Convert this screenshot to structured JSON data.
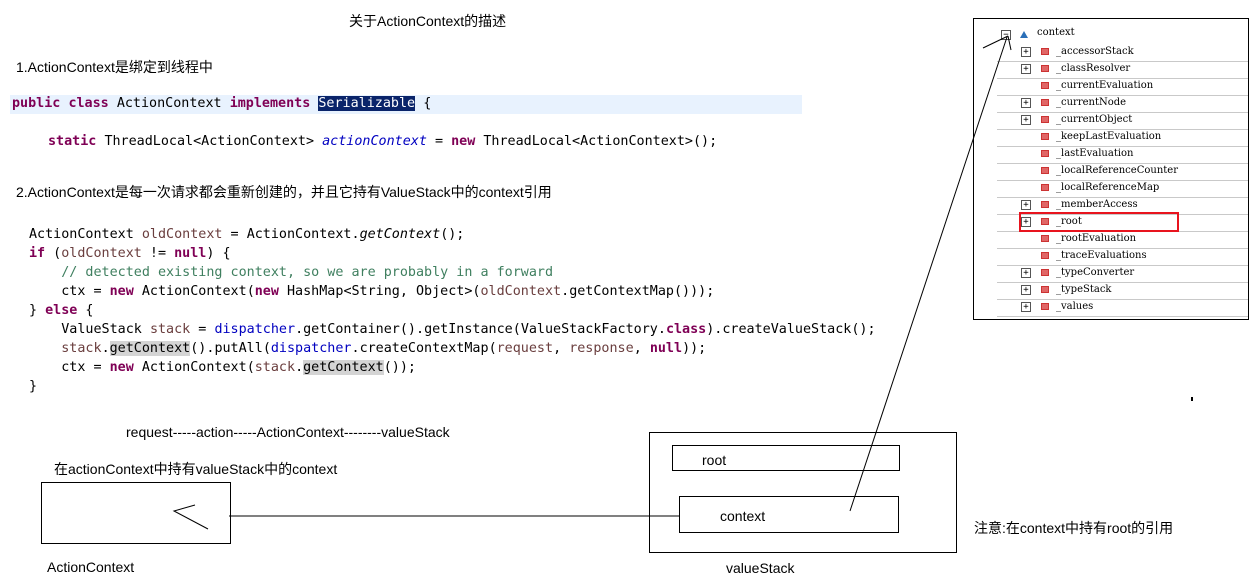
{
  "title": "关于ActionContext的描述",
  "section1": {
    "heading": "1.ActionContext是绑定到线程中"
  },
  "code1": {
    "kw_public": "public",
    "kw_class": "class",
    "class_name": "ActionContext",
    "kw_implements": "implements",
    "iface": "Serializable",
    "brace": "{",
    "kw_static": "static",
    "type1": "ThreadLocal<ActionContext>",
    "field": "actionContext",
    "eq": "=",
    "kw_new": "new",
    "ctor": "ThreadLocal<ActionContext>();"
  },
  "section2": {
    "heading": "2.ActionContext是每一次请求都会重新创建的，并且它持有ValueStack中的context引用"
  },
  "code2": {
    "lines": [
      "ActionContext oldContext = ActionContext.getContext();",
      "if (oldContext != null) {",
      "    // detected existing context, so we are probably in a forward",
      "    ctx = new ActionContext(new HashMap<String, Object>(oldContext.getContextMap()));",
      "} else {",
      "    ValueStack stack = dispatcher.getContainer().getInstance(ValueStackFactory.class).createValueStack();",
      "    stack.getContext().putAll(dispatcher.createContextMap(request, response, null));",
      "    ctx = new ActionContext(stack.getContext());",
      "}"
    ]
  },
  "diagram": {
    "flow_label": "request-----action-----ActionContext--------valueStack",
    "holds_label": "在actionContext中持有valueStack中的context",
    "action_context_label": "ActionContext",
    "value_stack_label": "valueStack",
    "root_label": "root",
    "context_label": "context",
    "note": "注意:在context中持有root的引用"
  },
  "tree": {
    "root_label": "context",
    "highlight_color": "#e8141e",
    "items": [
      {
        "label": "_accessorStack",
        "expandable": true
      },
      {
        "label": "_classResolver",
        "expandable": true
      },
      {
        "label": "_currentEvaluation",
        "expandable": false
      },
      {
        "label": "_currentNode",
        "expandable": true
      },
      {
        "label": "_currentObject",
        "expandable": true
      },
      {
        "label": "_keepLastEvaluation",
        "expandable": false
      },
      {
        "label": "_lastEvaluation",
        "expandable": false
      },
      {
        "label": "_localReferenceCounter",
        "expandable": false
      },
      {
        "label": "_localReferenceMap",
        "expandable": false
      },
      {
        "label": "_memberAccess",
        "expandable": true
      },
      {
        "label": "_root",
        "expandable": true,
        "highlighted": true
      },
      {
        "label": "_rootEvaluation",
        "expandable": false
      },
      {
        "label": "_traceEvaluations",
        "expandable": false
      },
      {
        "label": "_typeConverter",
        "expandable": true
      },
      {
        "label": "_typeStack",
        "expandable": true
      },
      {
        "label": "_values",
        "expandable": true
      }
    ],
    "expand_glyph": "+",
    "collapse_glyph": "−"
  }
}
